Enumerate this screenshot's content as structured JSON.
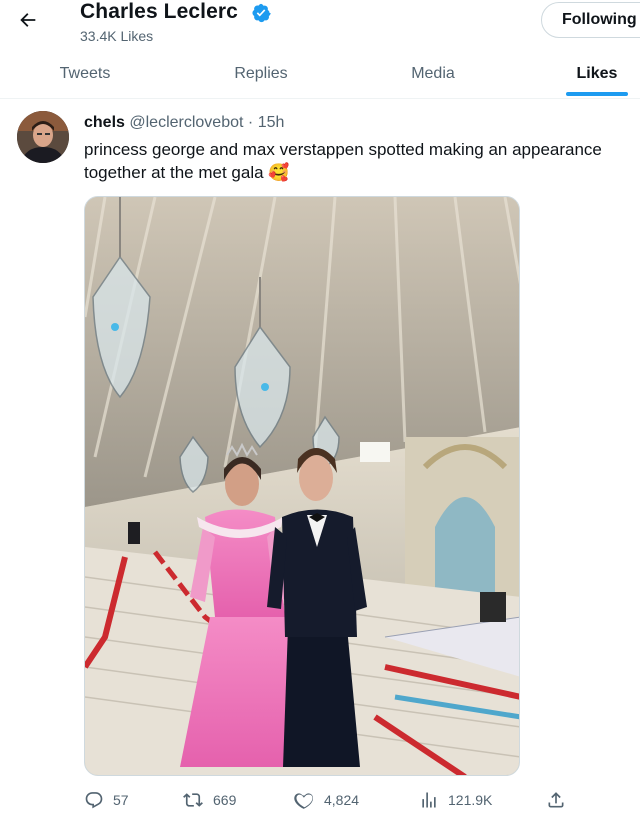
{
  "header": {
    "title": "Charles Leclerc",
    "likes_count": "33.4K Likes",
    "follow_button": "Following"
  },
  "tabs": [
    {
      "label": "Tweets"
    },
    {
      "label": "Replies"
    },
    {
      "label": "Media"
    },
    {
      "label": "Likes",
      "active": true
    }
  ],
  "tweet": {
    "display_name": "chels",
    "handle": "@leclerclovebot",
    "separator": "·",
    "time": "15h",
    "text": "princess george and max verstappen spotted making an appearance together at the met gala 🥰",
    "stats": {
      "replies": "57",
      "retweets": "669",
      "likes": "4,824",
      "views": "121.9K"
    }
  },
  "icons": {
    "back": "back-arrow-icon",
    "verified": "verified-badge-icon",
    "reply": "reply-icon",
    "retweet": "retweet-icon",
    "like": "heart-icon",
    "views": "views-icon",
    "share": "share-icon"
  },
  "colors": {
    "accent": "#1d9bf0",
    "text": "#0f1419",
    "muted": "#536471"
  }
}
